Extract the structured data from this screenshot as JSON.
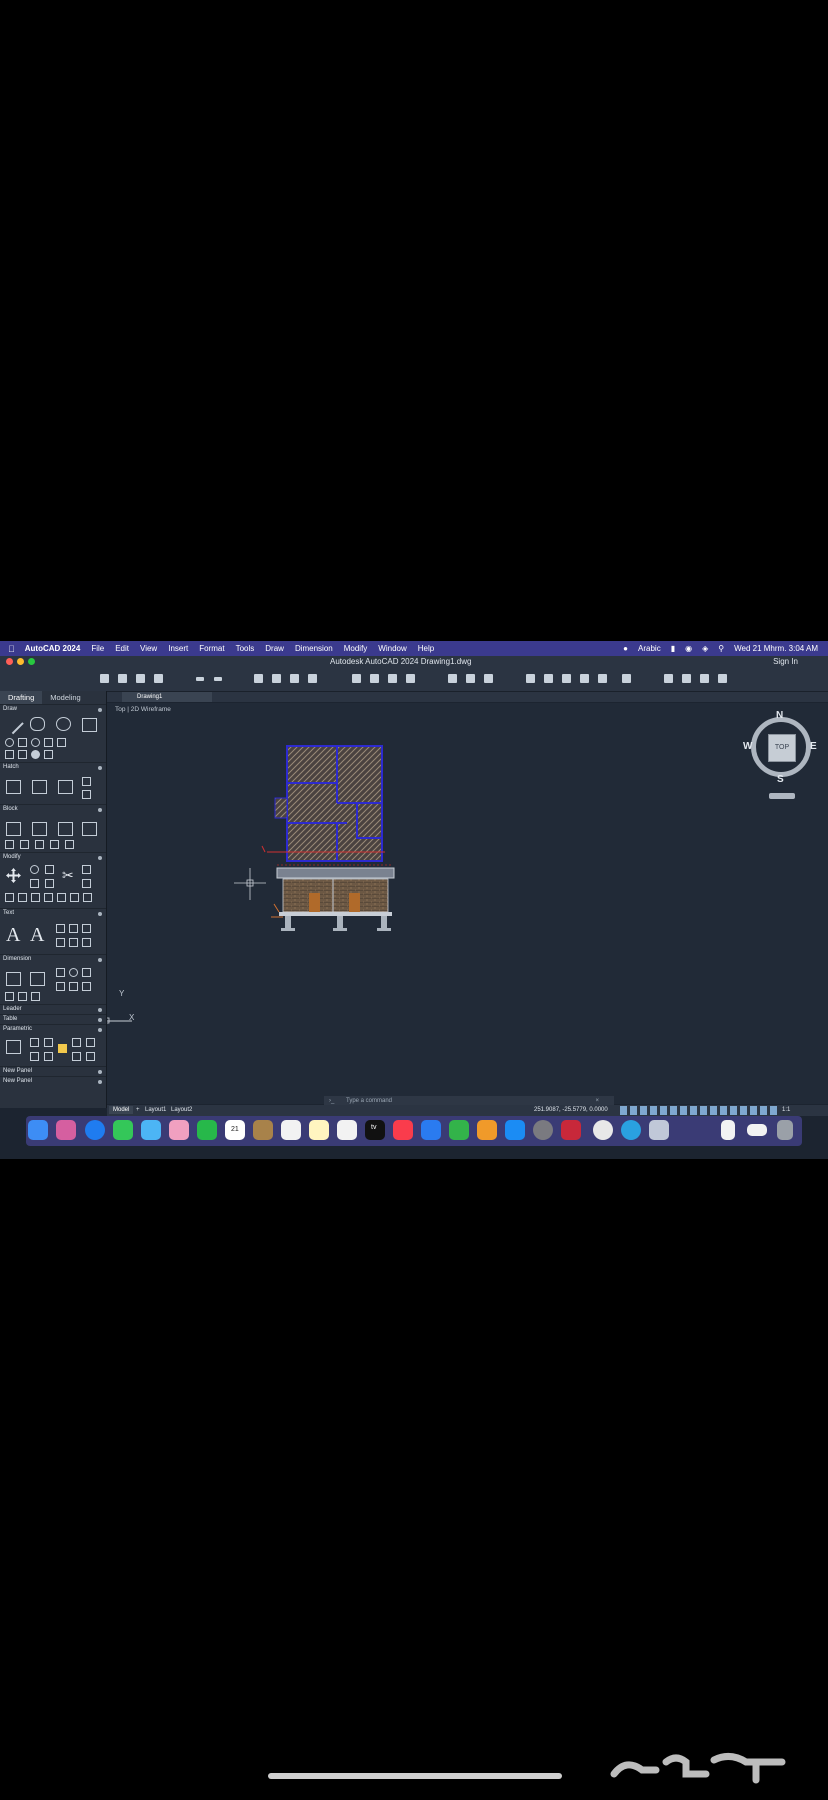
{
  "menubar": {
    "app_name": "AutoCAD 2024",
    "items": [
      "File",
      "Edit",
      "View",
      "Insert",
      "Format",
      "Tools",
      "Draw",
      "Dimension",
      "Modify",
      "Window",
      "Help"
    ],
    "input_source": "Arabic",
    "datetime": "Wed 21 Mhrm.  3:04 AM"
  },
  "window": {
    "title": "Autodesk AutoCAD 2024   Drawing1.dwg",
    "sign_in": "Sign In"
  },
  "palette": {
    "tabs": [
      "Drafting",
      "Modeling"
    ],
    "sections": [
      "Draw",
      "Hatch",
      "Block",
      "Modify",
      "Text",
      "Dimension",
      "Leader",
      "Table",
      "Parametric",
      "New Panel",
      "New Panel"
    ]
  },
  "document_tab": "Drawing1",
  "viewport": {
    "label": "Top | 2D Wireframe",
    "viewcube_face": "TOP",
    "compass": {
      "n": "N",
      "s": "S",
      "e": "E",
      "w": "W"
    },
    "ucs": {
      "x": "X",
      "y": "Y"
    },
    "command_placeholder": "Type a command"
  },
  "statusbar": {
    "tabs": [
      "Model",
      "Layout1",
      "Layout2"
    ],
    "coordinates": "251.9087, -25.5779, 0.0000",
    "scale": "1:1"
  },
  "dock": {
    "calendar_date": "21",
    "tv_label": "tv"
  },
  "colors": {
    "menubar_bg": "#3b3a8e",
    "canvas_bg": "#212a37",
    "plan_outline": "#2d2ad0",
    "hatch": "#7a6a5a"
  }
}
